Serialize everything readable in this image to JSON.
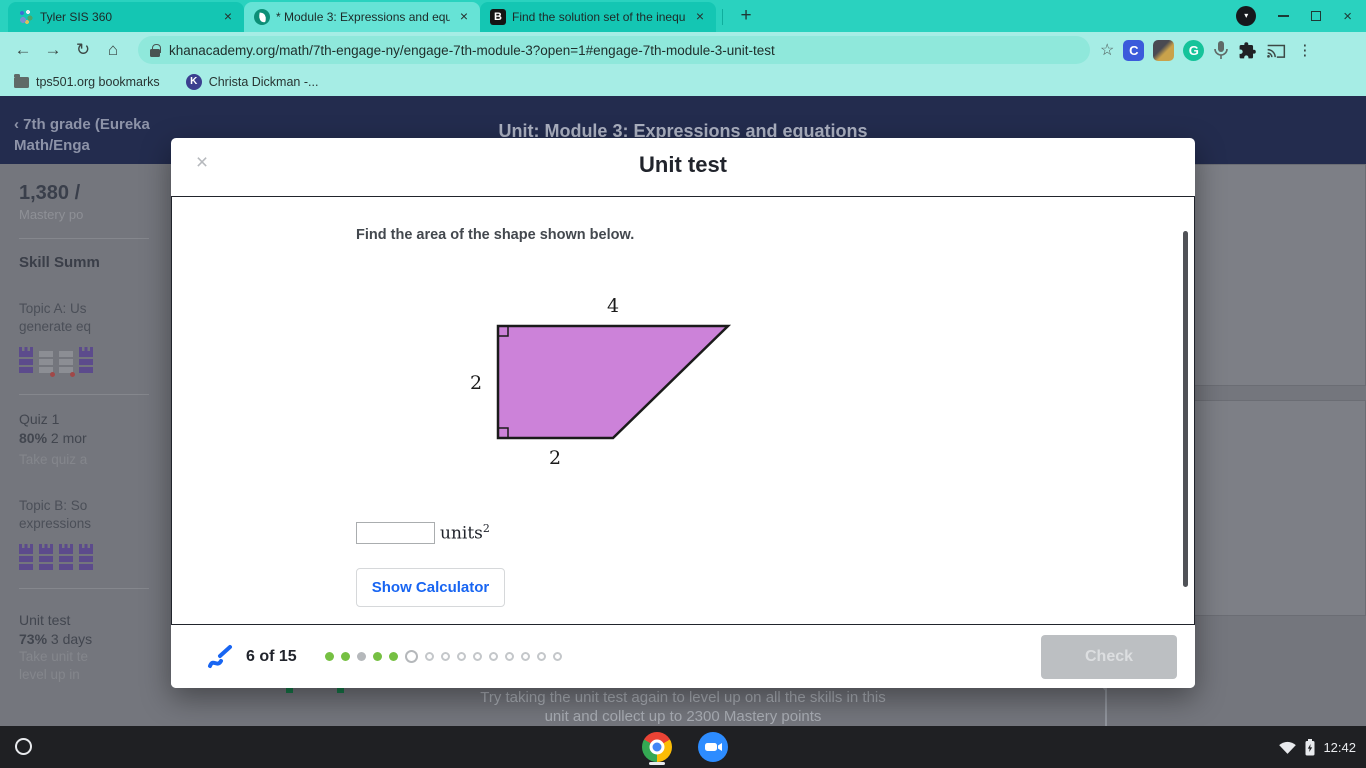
{
  "browser": {
    "tab_close": "×",
    "new_tab_button": "+",
    "tabs": [
      {
        "title": "Tyler SIS 360",
        "favicon": "tyler-sis"
      },
      {
        "title": "* Module 3: Expressions and equ",
        "favicon": "khan-academy-leaf"
      },
      {
        "title": "Find the solution set of the inequ",
        "favicon": "brainly",
        "favicon_text": "B"
      }
    ],
    "window_controls": {
      "avatar_chevron": "▾"
    },
    "nav": {
      "back": "←",
      "forward": "→",
      "reload": "↻",
      "home": "⌂"
    },
    "url": "khanacademy.org/math/7th-engage-ny/engage-7th-module-3?open=1#engage-7th-module-3-unit-test",
    "ext": {
      "star": "☆",
      "clever": "C",
      "grammarly": "G",
      "menu": "⋮"
    },
    "bookmarks": [
      {
        "label": "tps501.org bookmarks"
      },
      {
        "label": "Christa Dickman -...",
        "icon_text": "K"
      }
    ]
  },
  "background": {
    "breadcrumb": "‹ 7th grade (Eureka Math/Enga",
    "page_title": "Unit: Module 3: Expressions and equations",
    "mastery_points": "1,380 /",
    "mastery_label": "Mastery po",
    "skill_summary": "Skill Summ",
    "topic_a": "Topic A: Us generate eq",
    "quiz1_title": "Quiz 1",
    "quiz1_score": "80%",
    "quiz1_ago": " 2 mor",
    "quiz1_action": "Take quiz a",
    "topic_b": "Topic B: So expressions",
    "unittest_title": "Unit test",
    "unittest_score": "73%",
    "unittest_ago": " 3 days",
    "unittest_action1": "Take unit te",
    "unittest_action2": "level up in",
    "footer_line1": "Try taking the unit test again to level up on all the skills in this",
    "footer_line2": "unit and collect up to 2300 Mastery points"
  },
  "modal": {
    "title": "Unit test",
    "close": "×",
    "question": "Find the area of the shape shown below.",
    "shape": {
      "type": "trapezoid",
      "fill": "#cc82d9",
      "label_top": "4",
      "label_left": "2",
      "label_bottom": "2"
    },
    "answer": {
      "value": "",
      "units_label": "units",
      "units_exponent": "2"
    },
    "calculator_button": "Show Calculator",
    "progress": {
      "label": "6 of 15",
      "current": 6,
      "total": 15,
      "dots": [
        "filled-green",
        "filled-green",
        "filled-gray",
        "filled-green",
        "filled-green",
        "current",
        "empty",
        "empty",
        "empty",
        "empty",
        "empty",
        "empty",
        "empty",
        "empty",
        "empty"
      ]
    },
    "check_button": "Check"
  },
  "shelf": {
    "time": "12:42"
  }
}
